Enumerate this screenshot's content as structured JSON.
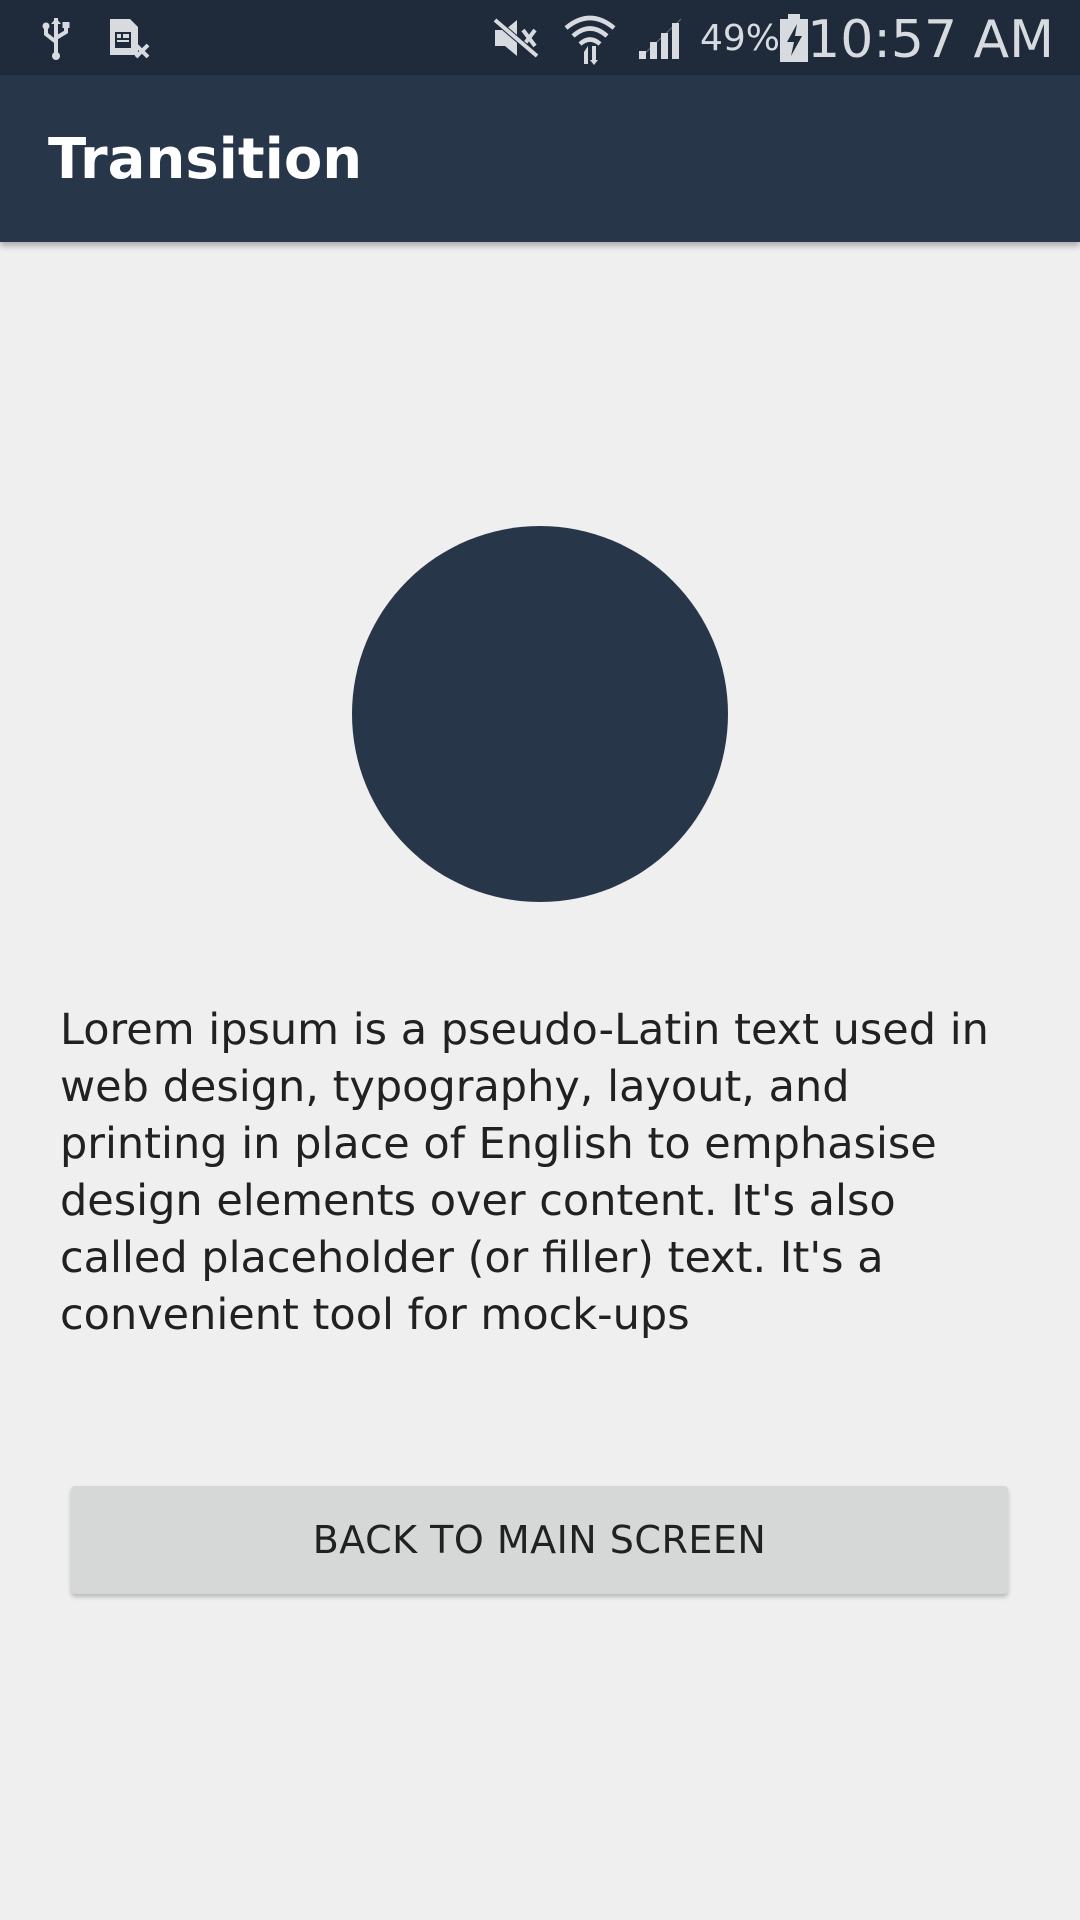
{
  "status_bar": {
    "icons": [
      "usb-icon",
      "sim-card-x-icon",
      "mute-icon",
      "wifi-icon",
      "signal-icon",
      "battery-charging-icon"
    ],
    "battery_percent": "49%",
    "time": "10:57 AM"
  },
  "app_bar": {
    "title": "Transition"
  },
  "main": {
    "circle_color": "#283649",
    "body_text": "Lorem ipsum is a pseudo-Latin text used in web design, typography, layout, and printing in place of English to emphasise design elements over content. It's also called placeholder (or filler) text. It's a convenient tool for mock-ups",
    "button_label": "BACK TO MAIN SCREEN"
  },
  "colors": {
    "status_bar": "#1f2b3a",
    "app_bar": "#283649",
    "background": "#efefef",
    "button": "#d6d7d7"
  }
}
